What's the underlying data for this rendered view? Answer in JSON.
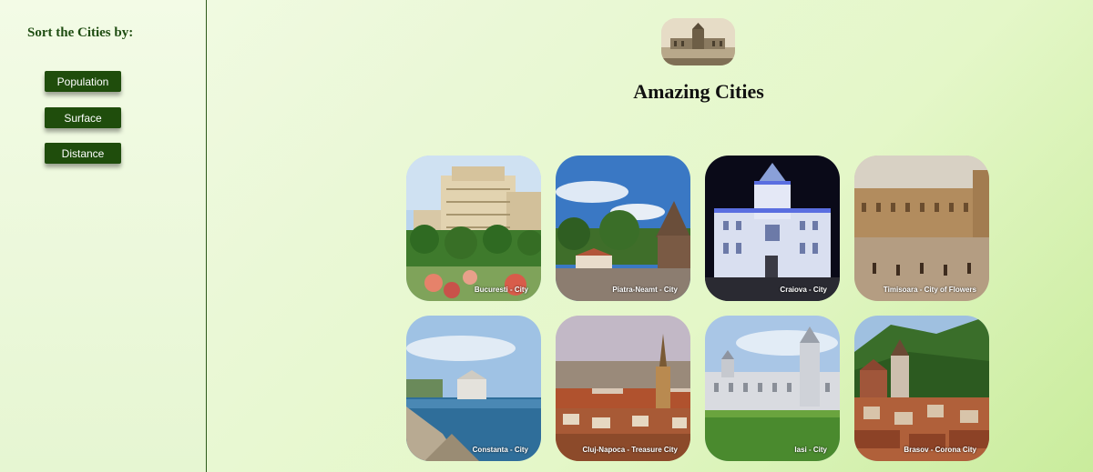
{
  "sidebar": {
    "title": "Sort the Cities by:",
    "buttons": [
      {
        "label": "Population"
      },
      {
        "label": "Surface"
      },
      {
        "label": "Distance"
      }
    ]
  },
  "header": {
    "title": "Amazing Cities"
  },
  "cities": [
    {
      "caption": "Bucuresti - City"
    },
    {
      "caption": "Piatra-Neamt - City"
    },
    {
      "caption": "Craiova - City"
    },
    {
      "caption": "Timisoara - City of Flowers"
    },
    {
      "caption": "Constanta - City"
    },
    {
      "caption": "Cluj-Napoca - Treasure City"
    },
    {
      "caption": "Iasi - City"
    },
    {
      "caption": "Brasov - Corona City"
    }
  ],
  "colors": {
    "button_bg": "#1f4d0c",
    "sidebar_border": "#2d5a1a",
    "sidebar_title": "#1f4d12"
  }
}
